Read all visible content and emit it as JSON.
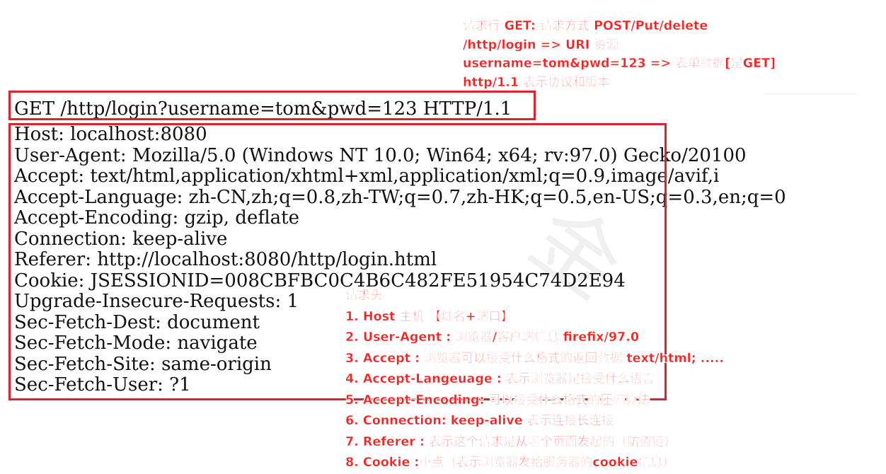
{
  "request_line": "GET /http/login?username=tom&pwd=123 HTTP/1.1",
  "headers": [
    "Host: localhost:8080",
    "User-Agent: Mozilla/5.0 (Windows NT 10.0; Win64; x64; rv:97.0) Gecko/20100",
    "Accept: text/html,application/xhtml+xml,application/xml;q=0.9,image/avif,i",
    "Accept-Language: zh-CN,zh;q=0.8,zh-TW;q=0.7,zh-HK;q=0.5,en-US;q=0.3,en;q=0",
    "Accept-Encoding: gzip, deflate",
    "Connection: keep-alive",
    "Referer: http://localhost:8080/http/login.html",
    "Cookie: JSESSIONID=008CBFBC0C4B6C482FE51954C74D2E94",
    "Upgrade-Insecure-Requests: 1",
    "Sec-Fetch-Dest: document",
    "Sec-Fetch-Mode: navigate",
    "Sec-Fetch-Site: same-origin",
    "Sec-Fetch-User: ?1"
  ],
  "request_line_notes": [
    "请求行 GET: 请求方式 POST/Put/delete",
    "/http/login => URI 资源",
    "username=tom&pwd=123 => 表单数据[是GET]",
    "http/1.1 表示协议和版本"
  ],
  "header_notes": {
    "title": "请求头",
    "items": [
      "1. Host 主机 【域名+端口】",
      "2. User-Agent : 浏览器/客户端信息 firefix/97.0",
      "3. Accept : 浏览器可以接受什么格式的返回数据 text/html; .....",
      "4. Accept-Langeuage : 表示浏览器是接受什么语言",
      "5. Accept-Encoding: 可以接受什么格式的压缩算法",
      "6. Connection: keep-alive 表示连接长连接",
      "7. Referer : 表示这个请求是从哪个页面发起的（防盗链）",
      "8. Cookie :重点（表示浏览器发给服务器的cookie信息）"
    ]
  },
  "colors": {
    "annotation": "#ff1d1d",
    "box": "#e0202a",
    "code_text": "#111111"
  }
}
